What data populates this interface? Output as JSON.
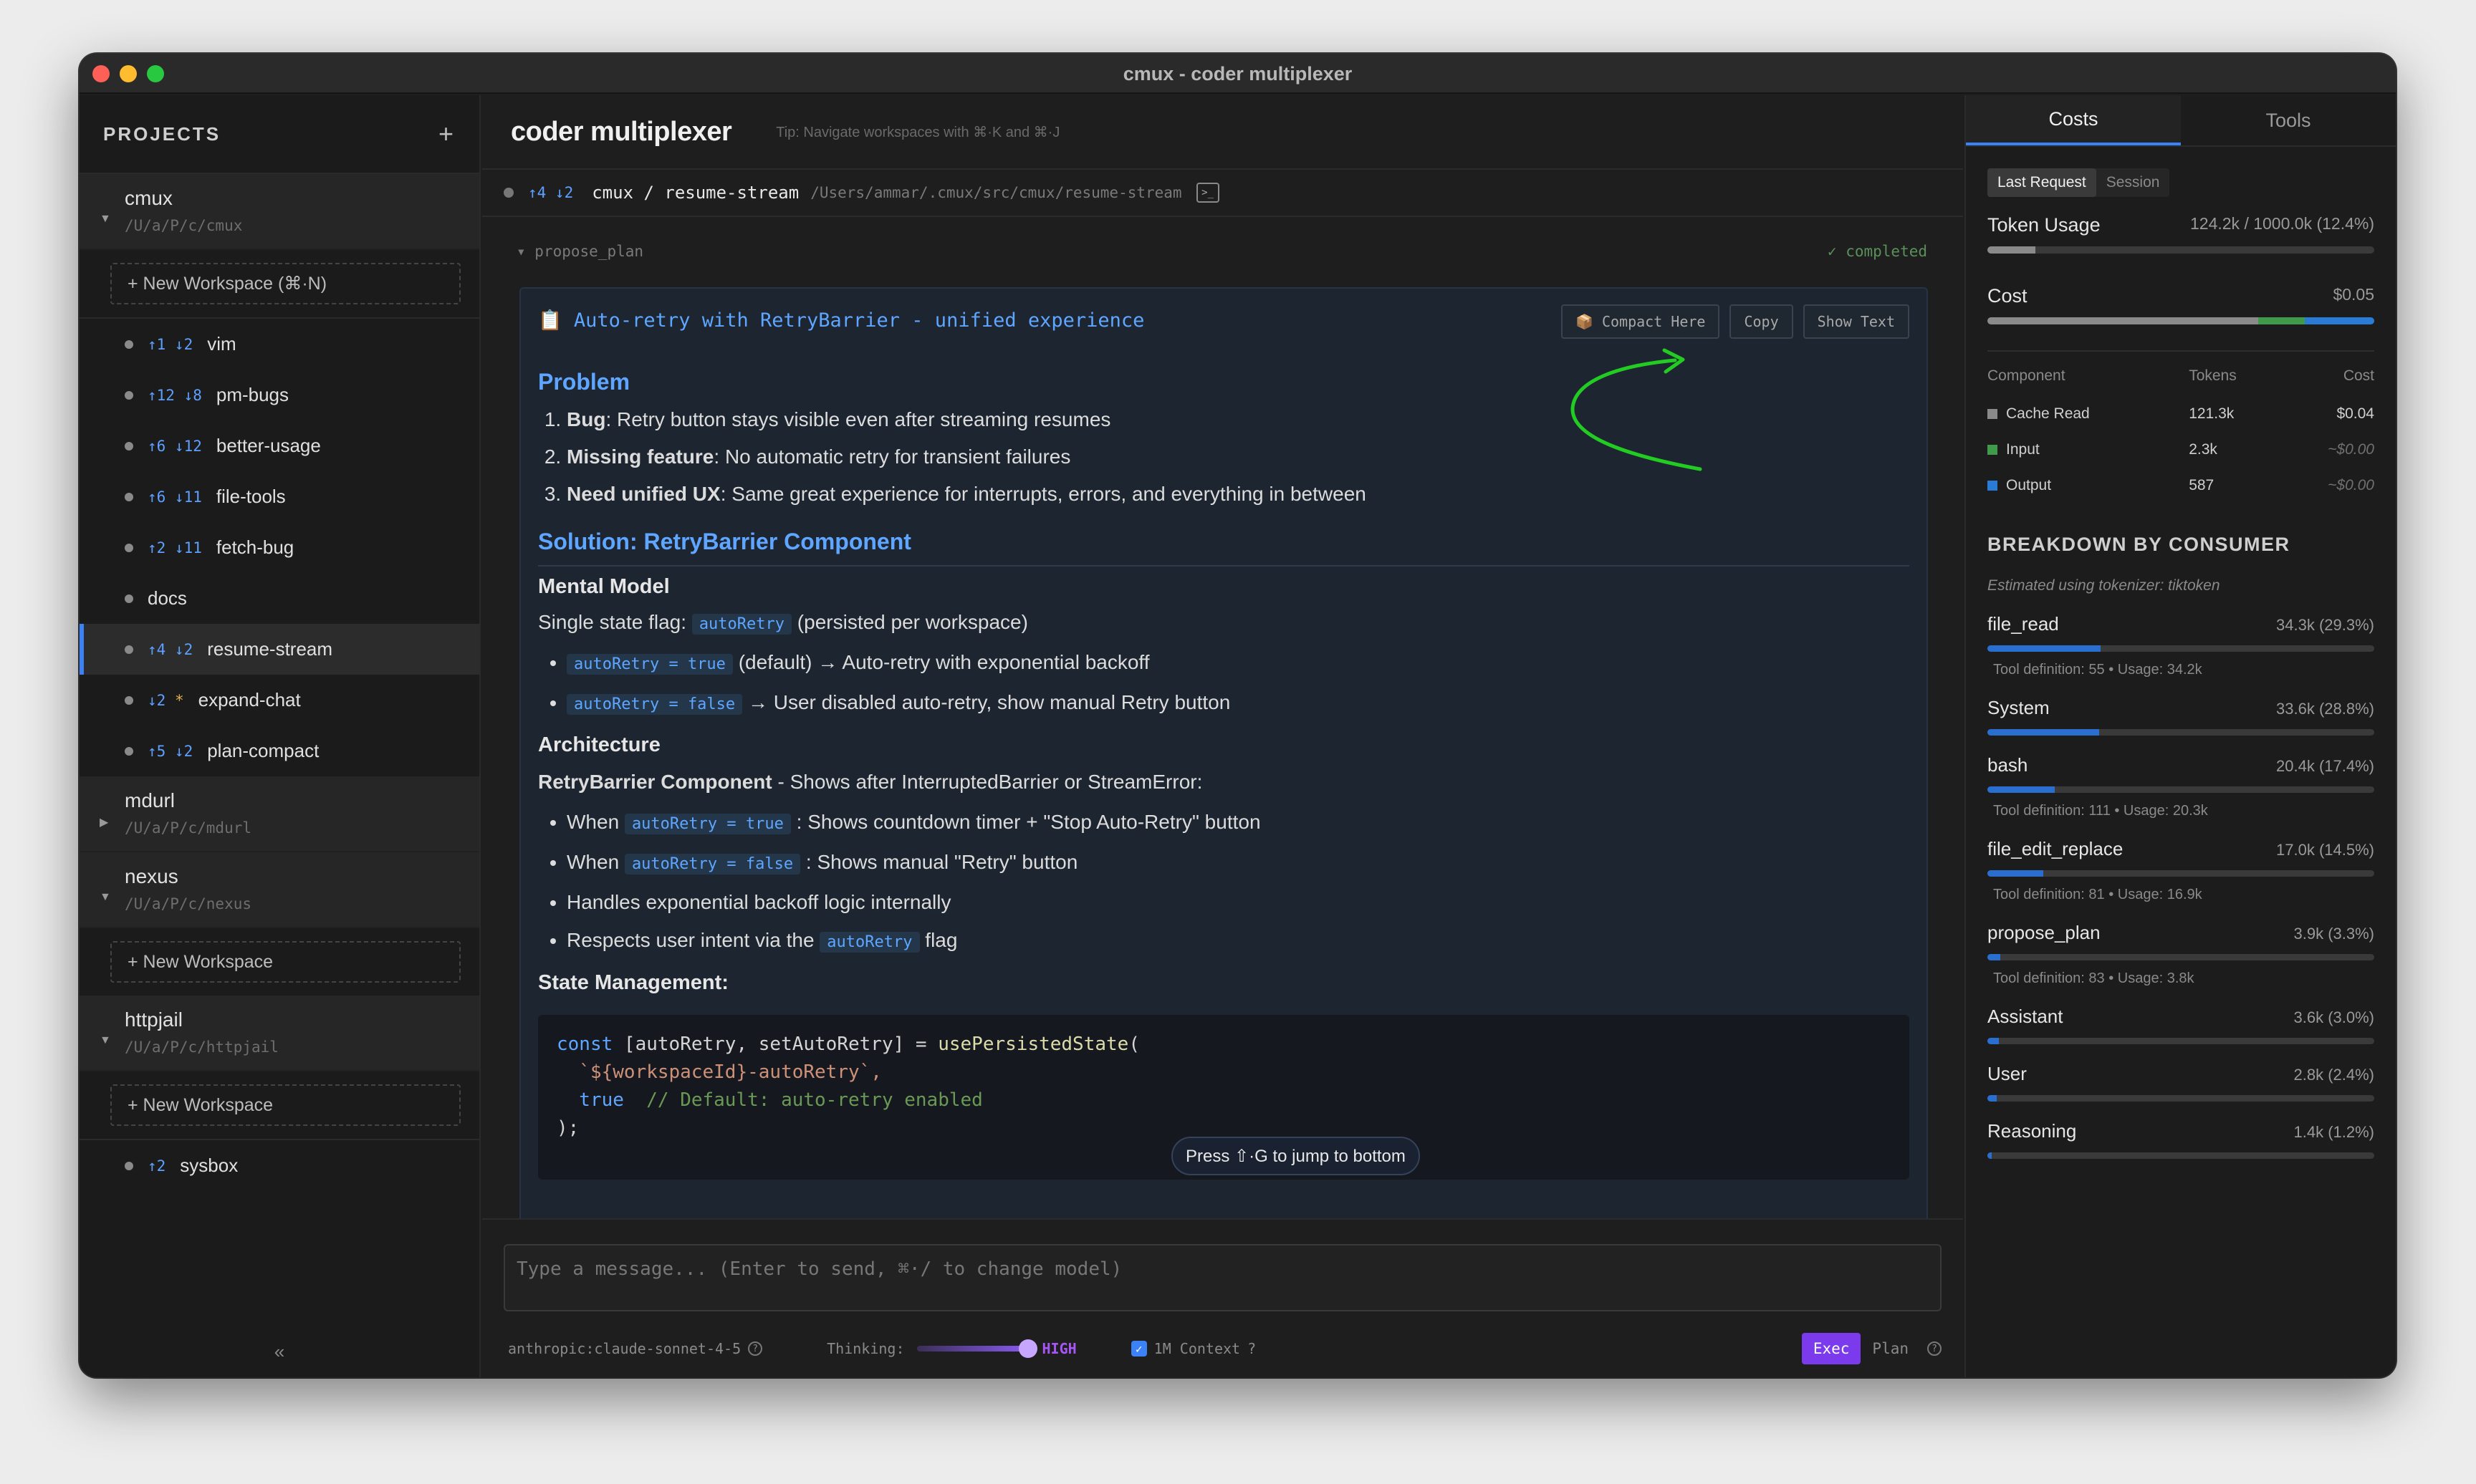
{
  "window": {
    "title": "cmux - coder multiplexer"
  },
  "sidebar": {
    "header_label": "PROJECTS",
    "add_icon": "+",
    "collapse_icon": "«",
    "projects": [
      {
        "name": "cmux",
        "path": "/U/a/P/c/cmux",
        "expanded": true,
        "new_workspace_label": "+ New Workspace (⌘·N)",
        "workspaces": [
          {
            "git": "↑1 ↓2",
            "name": "vim"
          },
          {
            "git": "↑12 ↓8",
            "name": "pm-bugs"
          },
          {
            "git": "↑6 ↓12",
            "name": "better-usage"
          },
          {
            "git": "↑6 ↓11",
            "name": "file-tools"
          },
          {
            "git": "↑2 ↓11",
            "name": "fetch-bug"
          },
          {
            "git": "",
            "name": "docs"
          },
          {
            "git": "↑4 ↓2",
            "name": "resume-stream",
            "active": true
          },
          {
            "git": "↓2",
            "star": "*",
            "name": "expand-chat"
          },
          {
            "git": "↑5 ↓2",
            "name": "plan-compact"
          }
        ]
      },
      {
        "name": "mdurl",
        "path": "/U/a/P/c/mdurl",
        "expanded": false
      },
      {
        "name": "nexus",
        "path": "/U/a/P/c/nexus",
        "expanded": true,
        "new_workspace_label": "+ New Workspace"
      },
      {
        "name": "httpjail",
        "path": "/U/a/P/c/httpjail",
        "expanded": true,
        "new_workspace_label": "+ New Workspace",
        "workspaces": [
          {
            "git": "↑2",
            "name": "sysbox"
          }
        ]
      }
    ]
  },
  "main": {
    "title": "coder multiplexer",
    "tip": "Tip:  Navigate workspaces with ⌘·K and ⌘·J",
    "workspace_bar": {
      "git": "↑4 ↓2",
      "name": "cmux / resume-stream",
      "path": "/Users/ammar/.cmux/src/cmux/resume-stream"
    },
    "tool": {
      "name": "propose_plan",
      "status": "✓ completed"
    },
    "plan": {
      "icon": "📋",
      "title": "Auto-retry with RetryBarrier - unified experience",
      "buttons": {
        "compact": "📦 Compact Here",
        "copy": "Copy",
        "show_text": "Show Text"
      },
      "problem_heading": "Problem",
      "problems": [
        {
          "bold": "Bug",
          "text": ": Retry button stays visible even after streaming resumes"
        },
        {
          "bold": "Missing feature",
          "text": ": No automatic retry for transient failures"
        },
        {
          "bold": "Need unified UX",
          "text": ": Same great experience for interrupts, errors, and everything in between"
        }
      ],
      "solution_heading": "Solution: RetryBarrier Component",
      "mental_model_heading": "Mental Model",
      "state_flag_prefix": "Single state flag: ",
      "state_flag_code": "autoRetry",
      "state_flag_suffix": " (persisted per workspace)",
      "flags": [
        {
          "code": "autoRetry = true",
          "text": " (default) → Auto-retry with exponential backoff"
        },
        {
          "code": "autoRetry = false",
          "text": " → User disabled auto-retry, show manual Retry button"
        }
      ],
      "architecture_heading": "Architecture",
      "component_bold": "RetryBarrier Component",
      "component_text": " - Shows after InterruptedBarrier or StreamError:",
      "behaviors": [
        {
          "pre": "When ",
          "code": "autoRetry = true",
          "post": " : Shows countdown timer + \"Stop Auto-Retry\" button"
        },
        {
          "pre": "When ",
          "code": "autoRetry = false",
          "post": " : Shows manual \"Retry\" button"
        },
        {
          "pre": "Handles exponential backoff logic internally",
          "code": "",
          "post": ""
        },
        {
          "pre": "Respects user intent via the ",
          "code": "autoRetry",
          "post": " flag"
        }
      ],
      "state_mgmt_heading": "State Management:",
      "code_lines": {
        "l1a": "const ",
        "l1b": "[autoRetry, setAutoRetry] = ",
        "l1c": "usePersistedState",
        "l1d": "(",
        "l2": "  `${workspaceId}-autoRetry`,",
        "l3a": "  true",
        "l3b": "  // Default: auto-retry enabled",
        "l4": ");"
      }
    },
    "jump_hint": "Press ⇧·G to jump to bottom",
    "composer": {
      "placeholder": "Type a message... (Enter to send, ⌘·/ to change model)",
      "model": "anthropic:claude-sonnet-4-5",
      "thinking_label": "Thinking:",
      "thinking_level": "HIGH",
      "context_label": "1M Context",
      "context_checked": true,
      "exec_label": "Exec",
      "plan_label": "Plan"
    }
  },
  "right_panel": {
    "tabs": [
      "Costs",
      "Tools"
    ],
    "segments": [
      "Last Request",
      "Session"
    ],
    "token_usage": {
      "label": "Token Usage",
      "value": "124.2k / 1000.0k (12.4%)",
      "fraction": 0.124
    },
    "cost": {
      "label": "Cost",
      "value": "$0.05"
    },
    "table": {
      "headers": [
        "Component",
        "Tokens",
        "Cost"
      ],
      "rows": [
        {
          "name": "Cache Read",
          "tokens": "121.3k",
          "cost": "$0.04",
          "color": "#8a8a8a"
        },
        {
          "name": "Input",
          "tokens": "2.3k",
          "cost": "~$0.00",
          "color": "#3f9a4a"
        },
        {
          "name": "Output",
          "tokens": "587",
          "cost": "~$0.00",
          "color": "#2a7bd6"
        }
      ]
    },
    "breakdown_title": "BREAKDOWN BY CONSUMER",
    "breakdown_sub": "Estimated using tokenizer: tiktoken",
    "consumers": [
      {
        "name": "file_read",
        "value": "34.3k (29.3%)",
        "fraction": 0.293,
        "detail": "Tool definition: 55 • Usage: 34.2k"
      },
      {
        "name": "System",
        "value": "33.6k (28.8%)",
        "fraction": 0.288,
        "detail": ""
      },
      {
        "name": "bash",
        "value": "20.4k (17.4%)",
        "fraction": 0.174,
        "detail": "Tool definition: 111 • Usage: 20.3k"
      },
      {
        "name": "file_edit_replace",
        "value": "17.0k (14.5%)",
        "fraction": 0.145,
        "detail": "Tool definition: 81 • Usage: 16.9k"
      },
      {
        "name": "propose_plan",
        "value": "3.9k (3.3%)",
        "fraction": 0.033,
        "detail": "Tool definition: 83 • Usage: 3.8k"
      },
      {
        "name": "Assistant",
        "value": "3.6k (3.0%)",
        "fraction": 0.03,
        "detail": ""
      },
      {
        "name": "User",
        "value": "2.8k (2.4%)",
        "fraction": 0.024,
        "detail": ""
      },
      {
        "name": "Reasoning",
        "value": "1.4k (1.2%)",
        "fraction": 0.012,
        "detail": ""
      }
    ]
  },
  "colors": {
    "accent": "#3b82f6",
    "plan_blue": "#5ea6ff",
    "exec_purple": "#7c3aed",
    "arrow_green": "#22cc22"
  }
}
